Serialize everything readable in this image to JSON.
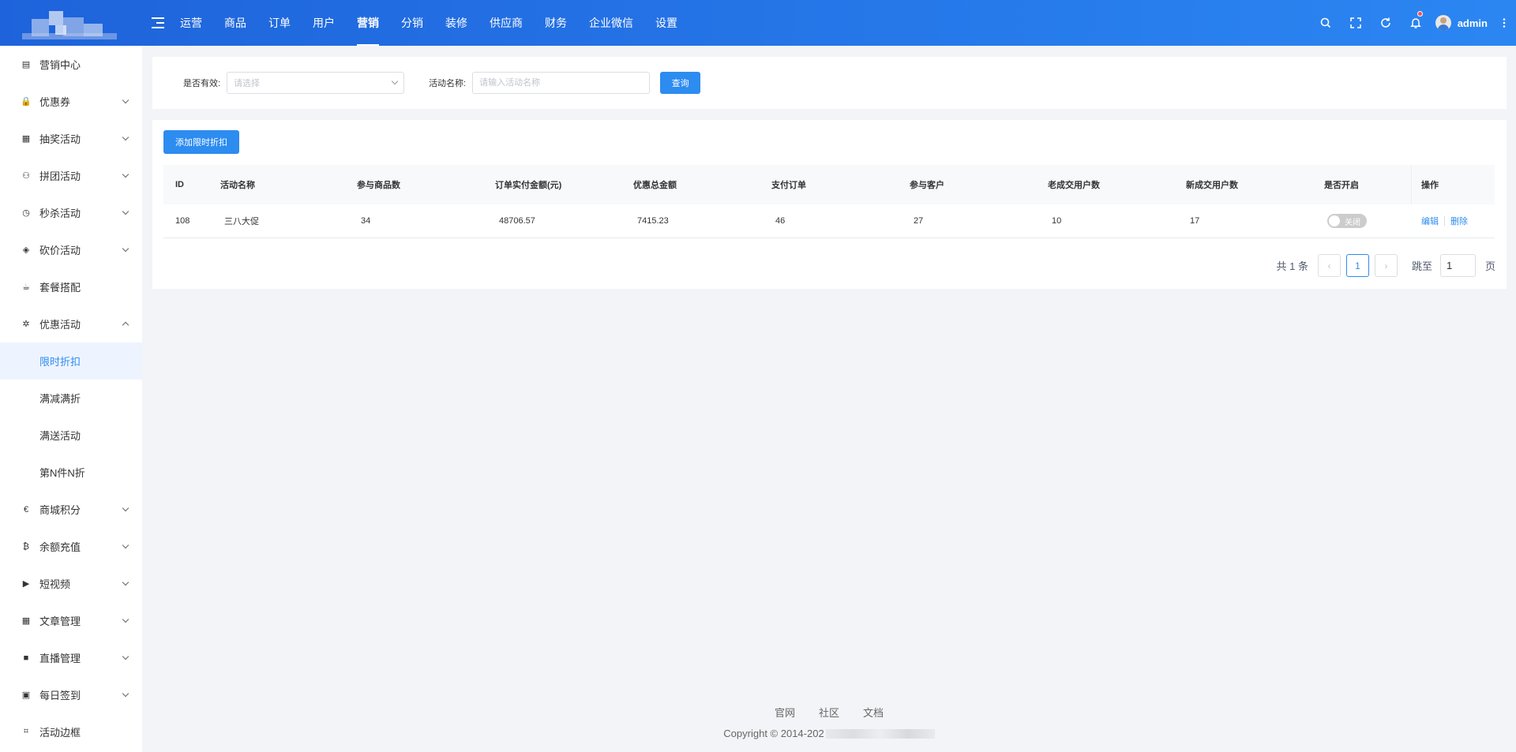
{
  "header": {
    "nav": [
      "运营",
      "商品",
      "订单",
      "用户",
      "营销",
      "分销",
      "装修",
      "供应商",
      "财务",
      "企业微信",
      "设置"
    ],
    "active_nav": "营销",
    "user_name": "admin"
  },
  "sidebar": {
    "items": [
      {
        "label": "营销中心",
        "icon": "book-icon",
        "glyph": "▤",
        "expandable": false
      },
      {
        "label": "优惠券",
        "icon": "lock-icon",
        "glyph": "🔒",
        "expandable": true
      },
      {
        "label": "抽奖活动",
        "icon": "grid-icon",
        "glyph": "▦",
        "expandable": true
      },
      {
        "label": "拼团活动",
        "icon": "group-icon",
        "glyph": "⚇",
        "expandable": true
      },
      {
        "label": "秒杀活动",
        "icon": "clock-icon",
        "glyph": "◷",
        "expandable": true
      },
      {
        "label": "砍价活动",
        "icon": "tag-icon",
        "glyph": "◈",
        "expandable": true
      },
      {
        "label": "套餐搭配",
        "icon": "cup-icon",
        "glyph": "☕",
        "expandable": false
      },
      {
        "label": "优惠活动",
        "icon": "gift-icon",
        "glyph": "✲",
        "expandable": true,
        "open": true,
        "children": [
          "限时折扣",
          "满减满折",
          "满送活动",
          "第N件N折"
        ],
        "active_child": "限时折扣"
      },
      {
        "label": "商城积分",
        "icon": "euro-icon",
        "glyph": "€",
        "expandable": true
      },
      {
        "label": "余额充值",
        "icon": "bitcoin-icon",
        "glyph": "₿",
        "expandable": true
      },
      {
        "label": "短视频",
        "icon": "youtube-icon",
        "glyph": "▶",
        "expandable": true
      },
      {
        "label": "文章管理",
        "icon": "document-icon",
        "glyph": "▦",
        "expandable": true
      },
      {
        "label": "直播管理",
        "icon": "video-icon",
        "glyph": "■",
        "expandable": true
      },
      {
        "label": "每日签到",
        "icon": "calendar-icon",
        "glyph": "▣",
        "expandable": true
      },
      {
        "label": "活动边框",
        "icon": "crop-icon",
        "glyph": "⌗",
        "expandable": false
      }
    ]
  },
  "filter": {
    "valid_label": "是否有效:",
    "valid_placeholder": "请选择",
    "name_label": "活动名称:",
    "name_placeholder": "请输入活动名称",
    "query_button": "查询"
  },
  "table": {
    "add_button": "添加限时折扣",
    "columns": [
      "ID",
      "活动名称",
      "参与商品数",
      "订单实付金额(元)",
      "优惠总金额",
      "支付订单",
      "参与客户",
      "老成交用户数",
      "新成交用户数",
      "是否开启",
      "操作"
    ],
    "rows": [
      {
        "id": "108",
        "name": "三八大促",
        "goods": "34",
        "paid": "48706.57",
        "discount": "7415.23",
        "orders": "46",
        "customers": "27",
        "old_users": "10",
        "new_users": "17",
        "enabled_text": "关闭",
        "edit": "编辑",
        "delete": "删除"
      }
    ]
  },
  "pagination": {
    "total_text": "共 1 条",
    "current_page": "1",
    "jump_label": "跳至",
    "jump_value": "1",
    "page_unit": "页"
  },
  "footer": {
    "links": [
      "官网",
      "社区",
      "文档"
    ],
    "copyright": "Copyright © 2014-202"
  }
}
